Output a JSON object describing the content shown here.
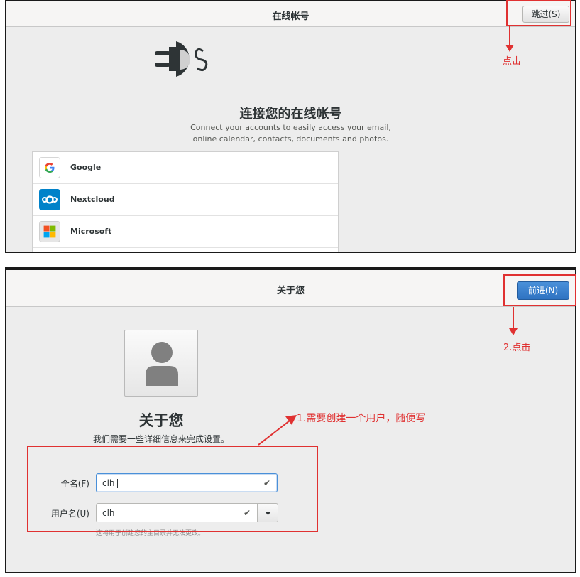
{
  "online_accounts": {
    "header_title": "在线帐号",
    "skip_button": "跳过(S)",
    "heading": "连接您的在线帐号",
    "description_line1": "Connect your accounts to easily access your email,",
    "description_line2": "online calendar, contacts, documents and photos.",
    "providers": [
      {
        "label": "Google",
        "icon": "google-icon"
      },
      {
        "label": "Nextcloud",
        "icon": "nextcloud-icon"
      },
      {
        "label": "Microsoft",
        "icon": "microsoft-icon"
      }
    ],
    "annotation": "点击"
  },
  "about_you": {
    "header_title": "关于您",
    "next_button": "前进(N)",
    "avatar_icon": "user-avatar-icon",
    "heading": "关于您",
    "subheading": "我们需要一些详细信息来完成设置。",
    "full_name_label": "全名(F)",
    "full_name_value": "clh",
    "username_label": "用户名(U)",
    "username_value": "clh",
    "hint": "这将用于创建您的主目录并无法更改。",
    "annotation_next": "2.点击",
    "annotation_form": "1.需要创建一个用户，随便写"
  },
  "colors": {
    "annotation_red": "#e03131",
    "accent_blue": "#3478c6"
  }
}
